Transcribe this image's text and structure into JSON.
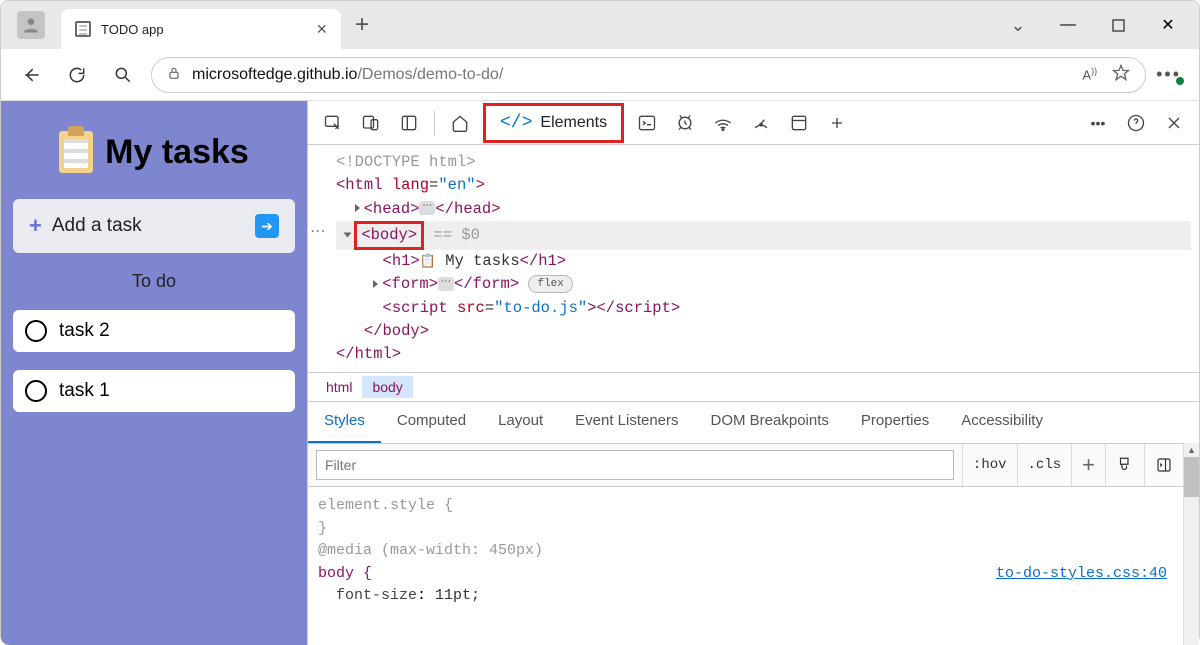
{
  "browser": {
    "tab_title": "TODO app",
    "url_host": "microsoftedge.github.io",
    "url_path": "/Demos/demo-to-do/",
    "read_aloud": "A))",
    "win_min": "—",
    "win_max": "▢",
    "win_close": "✕"
  },
  "app": {
    "title": "My tasks",
    "add_placeholder": "Add a task",
    "section": "To do",
    "tasks": [
      {
        "name": "task 2"
      },
      {
        "name": "task 1"
      }
    ]
  },
  "devtools": {
    "elements_label": "Elements",
    "dom": {
      "doctype": "<!DOCTYPE html>",
      "html_open": "<html lang=\"en\">",
      "head": "head",
      "body": "body",
      "eq0": " == $0",
      "h1_text": " My tasks",
      "form": "form",
      "flex_badge": "flex",
      "script_open": "<script src=\"to-do.js\">",
      "html_close": "</html>"
    },
    "crumbs": {
      "html": "html",
      "body": "body"
    },
    "subtabs": [
      "Styles",
      "Computed",
      "Layout",
      "Event Listeners",
      "DOM Breakpoints",
      "Properties",
      "Accessibility"
    ],
    "filter_placeholder": "Filter",
    "tools": {
      "hov": ":hov",
      "cls": ".cls"
    },
    "css": {
      "elstyle": "element.style {",
      "close": "}",
      "media": "@media (max-width: 450px)",
      "body": "body {",
      "prop": "font-size",
      "val": "11pt;",
      "link": "to-do-styles.css:40"
    }
  }
}
